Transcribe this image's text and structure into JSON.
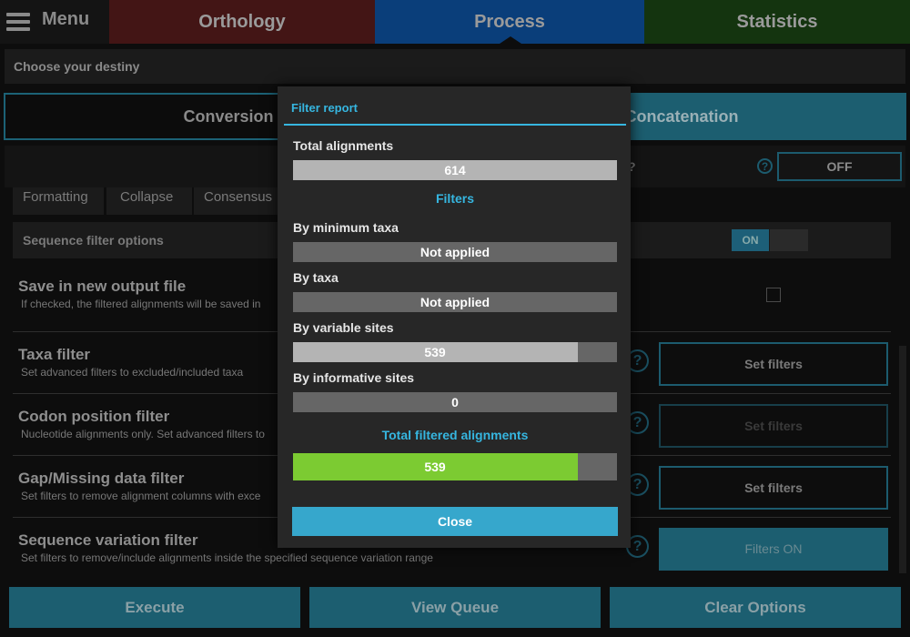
{
  "topbar": {
    "menu_label": "Menu",
    "tabs": [
      {
        "label": "Orthology"
      },
      {
        "label": "Process"
      },
      {
        "label": "Statistics"
      }
    ]
  },
  "destiny": {
    "label": "Choose your destiny"
  },
  "modes": {
    "conversion": "Conversion",
    "concatenation": "Concatenation"
  },
  "subrow": {
    "question_fragment": "?",
    "help": "?",
    "toggle_value": "OFF"
  },
  "subtabs": [
    "Formatting",
    "Collapse",
    "Consensus"
  ],
  "sequence_filter_options": {
    "label": "Sequence filter options",
    "toggle_on": "ON"
  },
  "options": [
    {
      "title": "Save in new output file",
      "desc": "If checked, the filtered alignments will be saved in"
    },
    {
      "title": "Taxa filter",
      "desc": "Set advanced filters to excluded/included taxa",
      "button": "Set filters"
    },
    {
      "title": "Codon position filter",
      "desc": "Nucleotide alignments only. Set advanced filters to",
      "button": "Set filters"
    },
    {
      "title": "Gap/Missing data filter",
      "desc": "Set filters to remove alignment columns with exce",
      "button": "Set filters"
    },
    {
      "title": "Sequence variation filter",
      "desc": "Set filters to remove/include alignments inside the specified sequence variation range",
      "button": "Filters ON"
    }
  ],
  "help_icon": "?",
  "bottom_buttons": {
    "execute": "Execute",
    "view_queue": "View Queue",
    "clear_options": "Clear Options"
  },
  "modal": {
    "title": "Filter report",
    "total_alignments_label": "Total alignments",
    "total_alignments": "614",
    "filters_heading": "Filters",
    "filters": [
      {
        "label": "By minimum taxa",
        "value": "Not applied",
        "fraction": 0
      },
      {
        "label": "By taxa",
        "value": "Not applied",
        "fraction": 0
      },
      {
        "label": "By variable sites",
        "value": "539",
        "fraction": 0.878
      },
      {
        "label": "By informative sites",
        "value": "0",
        "fraction": 0
      }
    ],
    "total_filtered_label": "Total filtered alignments",
    "total_filtered": "539",
    "total_filtered_fraction": 0.878,
    "close_label": "Close"
  },
  "colors": {
    "accent": "#36b6e0",
    "orthology_tab": "#431515",
    "process_tab": "#0a3e7a",
    "statistics_tab": "#14340f",
    "filtered_bar": "#7ccb32"
  }
}
